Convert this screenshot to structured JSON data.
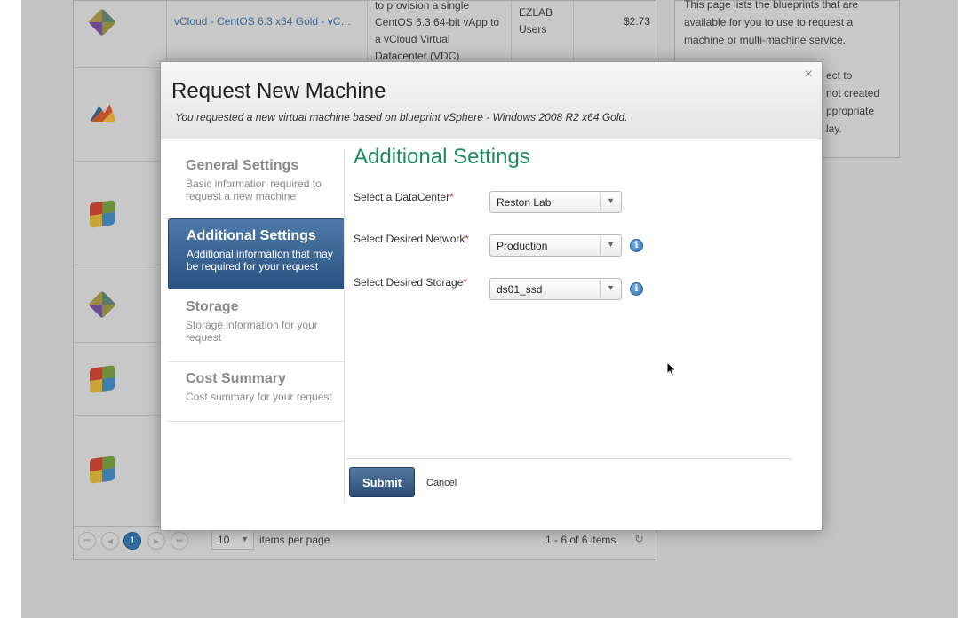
{
  "background": {
    "rows": [
      {
        "icon": "centos-icon",
        "name": "vCloud - CentOS 6.3 x64 Gold - vC…",
        "description": "to provision a single CentOS 6.3 64-bit vApp to a vCloud Virtual Datacenter (VDC)",
        "group": "EZLAB Users",
        "cost": "$2.73"
      },
      {
        "icon": "mountain-icon"
      },
      {
        "icon": "windows-icon"
      },
      {
        "icon": "centos-icon"
      },
      {
        "icon": "windows-icon"
      },
      {
        "icon": "windows-7-icon"
      }
    ],
    "help_text_1": "This page lists the blueprints that are available for you to use to request a machine or multi-machine service.",
    "help_text_2_fragments": [
      "ect to",
      "not created",
      "ppropriate",
      "lay."
    ],
    "pager": {
      "current_page": "1",
      "page_size": "10",
      "items_per_page_label": "items per page",
      "range": "1 - 6 of 6 items"
    }
  },
  "modal": {
    "title": "Request New Machine",
    "subtitle": "You requested a new virtual machine based on blueprint vSphere - Windows 2008 R2 x64 Gold.",
    "close": "×",
    "nav": [
      {
        "title": "General Settings",
        "desc": "Basic information required to request a new machine"
      },
      {
        "title": "Additional Settings",
        "desc": "Additional information that may be required for your request"
      },
      {
        "title": "Storage",
        "desc": "Storage information for your request"
      },
      {
        "title": "Cost Summary",
        "desc": "Cost summary for your request"
      }
    ],
    "content_title": "Additional Settings",
    "fields": {
      "datacenter": {
        "label": "Select a DataCenter",
        "value": "Reston Lab"
      },
      "network": {
        "label": "Select Desired Network",
        "value": "Production"
      },
      "storage": {
        "label": "Select Desired Storage",
        "value": "ds01_ssd"
      }
    },
    "required_marker": "*",
    "submit_label": "Submit",
    "cancel_label": "Cancel"
  }
}
